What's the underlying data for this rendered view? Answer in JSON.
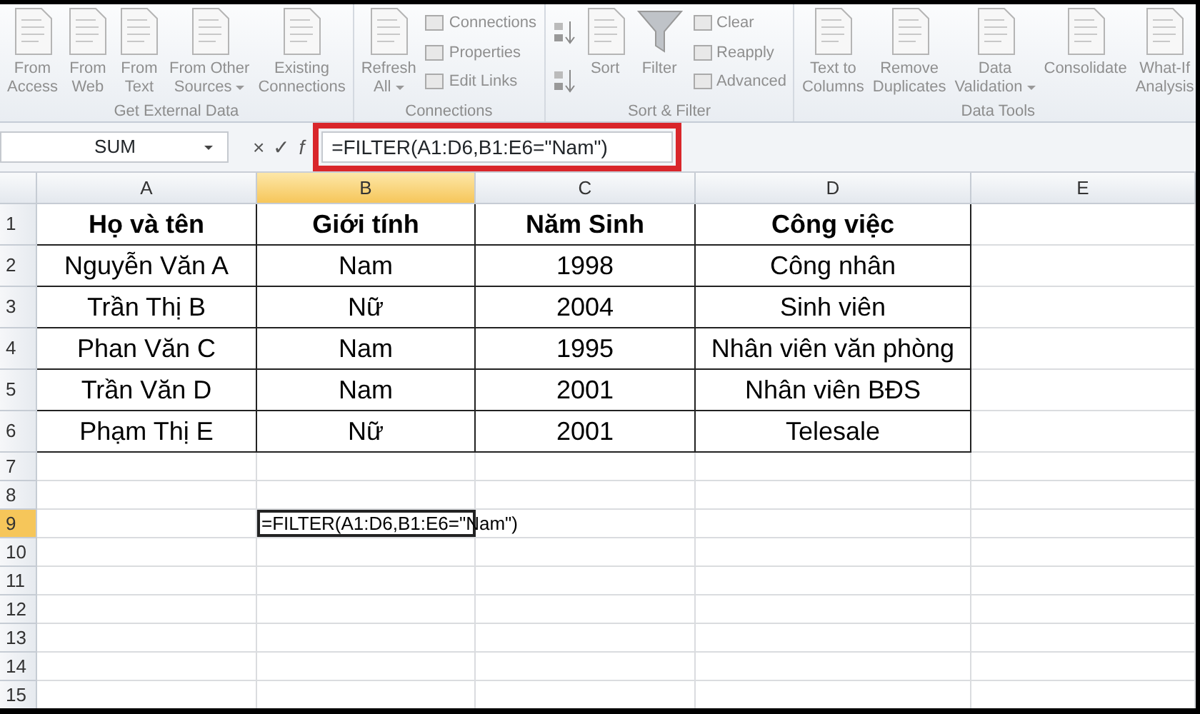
{
  "ribbon": {
    "groups": [
      {
        "label": "Get External Data",
        "items": [
          {
            "kind": "large",
            "lines": [
              "From",
              "Access"
            ],
            "caret": false
          },
          {
            "kind": "large",
            "lines": [
              "From",
              "Web"
            ],
            "caret": false
          },
          {
            "kind": "large",
            "lines": [
              "From",
              "Text"
            ],
            "caret": false
          },
          {
            "kind": "large",
            "lines": [
              "From Other",
              "Sources"
            ],
            "caret": true
          },
          {
            "kind": "large",
            "lines": [
              "Existing",
              "Connections"
            ],
            "caret": false
          }
        ]
      },
      {
        "label": "Connections",
        "items": [
          {
            "kind": "large",
            "lines": [
              "Refresh",
              "All"
            ],
            "caret": true
          },
          {
            "kind": "small-stack",
            "labels": [
              "Connections",
              "Properties",
              "Edit Links"
            ]
          }
        ]
      },
      {
        "label": "Sort & Filter",
        "items": [
          {
            "kind": "sort-pair"
          },
          {
            "kind": "large",
            "lines": [
              "Sort"
            ],
            "caret": false
          },
          {
            "kind": "filter",
            "lines": [
              "Filter"
            ],
            "caret": false
          },
          {
            "kind": "small-stack",
            "labels": [
              "Clear",
              "Reapply",
              "Advanced"
            ]
          }
        ]
      },
      {
        "label": "Data Tools",
        "items": [
          {
            "kind": "large",
            "lines": [
              "Text to",
              "Columns"
            ],
            "caret": false
          },
          {
            "kind": "large",
            "lines": [
              "Remove",
              "Duplicates"
            ],
            "caret": false
          },
          {
            "kind": "large",
            "lines": [
              "Data",
              "Validation"
            ],
            "caret": true
          },
          {
            "kind": "large",
            "lines": [
              "Consolidate"
            ],
            "caret": false
          },
          {
            "kind": "large",
            "lines": [
              "What-If",
              "Analysis"
            ],
            "caret": false
          }
        ]
      }
    ]
  },
  "formula_bar": {
    "name_box": "SUM",
    "cancel": "×",
    "enter": "✓",
    "function": "f",
    "formula": "=FILTER(A1:D6,B1:E6=\"Nam\")",
    "highlighted": true
  },
  "sheet": {
    "columns": [
      {
        "label": "A",
        "selected": false
      },
      {
        "label": "B",
        "selected": true
      },
      {
        "label": "C",
        "selected": false
      },
      {
        "label": "D",
        "selected": false
      },
      {
        "label": "E",
        "selected": false
      }
    ],
    "rows": [
      {
        "number": "1",
        "selected": false,
        "kind": "header",
        "cells": [
          {
            "text": "Họ và tên",
            "active": false
          },
          {
            "text": "Giới tính",
            "active": false
          },
          {
            "text": "Năm Sinh",
            "active": false
          },
          {
            "text": "Công việc",
            "active": false
          }
        ]
      },
      {
        "number": "2",
        "selected": false,
        "kind": "data",
        "cells": [
          {
            "text": "Nguyễn Văn A",
            "active": false
          },
          {
            "text": "Nam",
            "active": false
          },
          {
            "text": "1998",
            "active": false
          },
          {
            "text": "Công nhân",
            "active": false
          }
        ]
      },
      {
        "number": "3",
        "selected": false,
        "kind": "data",
        "cells": [
          {
            "text": "Trần Thị B",
            "active": false
          },
          {
            "text": "Nữ",
            "active": false
          },
          {
            "text": "2004",
            "active": false
          },
          {
            "text": "Sinh viên",
            "active": false
          }
        ]
      },
      {
        "number": "4",
        "selected": false,
        "kind": "data",
        "cells": [
          {
            "text": "Phan Văn C",
            "active": false
          },
          {
            "text": "Nam",
            "active": false
          },
          {
            "text": "1995",
            "active": false
          },
          {
            "text": "Nhân viên văn phòng",
            "active": false
          }
        ]
      },
      {
        "number": "5",
        "selected": false,
        "kind": "data",
        "cells": [
          {
            "text": "Trần Văn D",
            "active": false
          },
          {
            "text": "Nam",
            "active": false
          },
          {
            "text": "2001",
            "active": false
          },
          {
            "text": "Nhân viên BĐS",
            "active": false
          }
        ]
      },
      {
        "number": "6",
        "selected": false,
        "kind": "data",
        "cells": [
          {
            "text": "Phạm Thị E",
            "active": false
          },
          {
            "text": "Nữ",
            "active": false
          },
          {
            "text": "2001",
            "active": false
          },
          {
            "text": "Telesale",
            "active": false
          }
        ]
      },
      {
        "number": "7",
        "selected": false,
        "kind": "blank"
      },
      {
        "number": "8",
        "selected": false,
        "kind": "blank"
      },
      {
        "number": "9",
        "selected": true,
        "kind": "blank",
        "cells": [
          null,
          {
            "text": "=FILTER(A1:D6,B1:E6=\"Nam\")",
            "active": true
          }
        ]
      },
      {
        "number": "10",
        "selected": false,
        "kind": "blank"
      },
      {
        "number": "11",
        "selected": false,
        "kind": "blank"
      },
      {
        "number": "12",
        "selected": false,
        "kind": "blank"
      },
      {
        "number": "13",
        "selected": false,
        "kind": "blank"
      },
      {
        "number": "14",
        "selected": false,
        "kind": "blank"
      },
      {
        "number": "15",
        "selected": false,
        "kind": "blank"
      }
    ]
  }
}
